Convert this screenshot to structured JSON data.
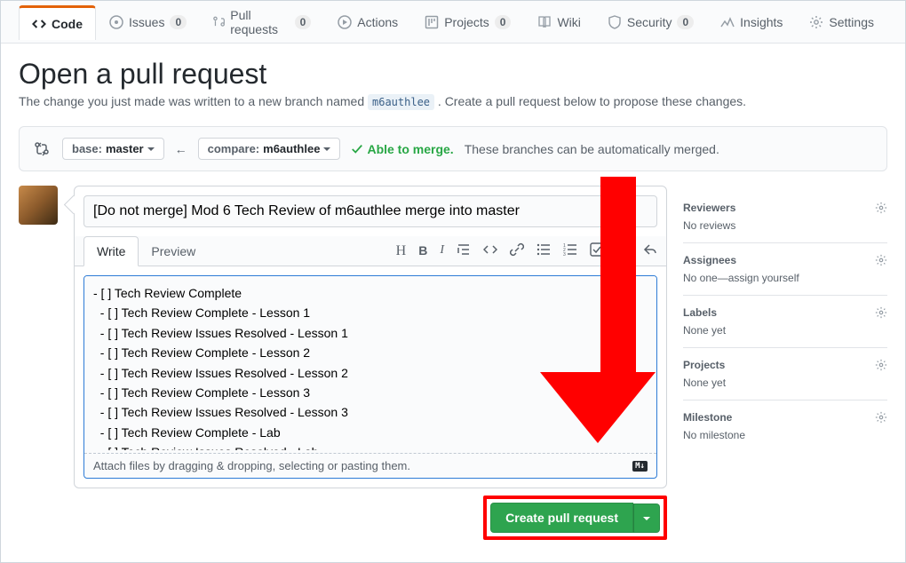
{
  "tabs": {
    "code": "Code",
    "issues": "Issues",
    "issues_count": "0",
    "pulls": "Pull requests",
    "pulls_count": "0",
    "actions": "Actions",
    "projects": "Projects",
    "projects_count": "0",
    "wiki": "Wiki",
    "security": "Security",
    "security_count": "0",
    "insights": "Insights",
    "settings": "Settings"
  },
  "heading": "Open a pull request",
  "subtitle_a": "The change you just made was written to a new branch named ",
  "subtitle_branch": "m6authlee",
  "subtitle_b": ". Create a pull request below to propose these changes.",
  "base": {
    "label": "base:",
    "name": "master"
  },
  "compare": {
    "label": "compare:",
    "name": "m6authlee"
  },
  "merge_ok": "Able to merge.",
  "merge_note": "These branches can be automatically merged.",
  "pr_title": "[Do not merge] Mod 6 Tech Review of m6authlee merge into master",
  "editor_tabs": {
    "write": "Write",
    "preview": "Preview"
  },
  "body": "- [ ] Tech Review Complete\n  - [ ] Tech Review Complete - Lesson 1\n  - [ ] Tech Review Issues Resolved - Lesson 1\n  - [ ] Tech Review Complete - Lesson 2\n  - [ ] Tech Review Issues Resolved - Lesson 2\n  - [ ] Tech Review Complete - Lesson 3\n  - [ ] Tech Review Issues Resolved - Lesson 3\n  - [ ] Tech Review Complete - Lab\n  - [ ] Tech Review Issues Resolved - Lab",
  "attach_hint": "Attach files by dragging & dropping, selecting or pasting them.",
  "submit": "Create pull request",
  "sidebar": {
    "reviewers": {
      "title": "Reviewers",
      "body": "No reviews"
    },
    "assignees": {
      "title": "Assignees",
      "body": "No one—assign yourself"
    },
    "labels": {
      "title": "Labels",
      "body": "None yet"
    },
    "projects": {
      "title": "Projects",
      "body": "None yet"
    },
    "milestone": {
      "title": "Milestone",
      "body": "No milestone"
    }
  }
}
